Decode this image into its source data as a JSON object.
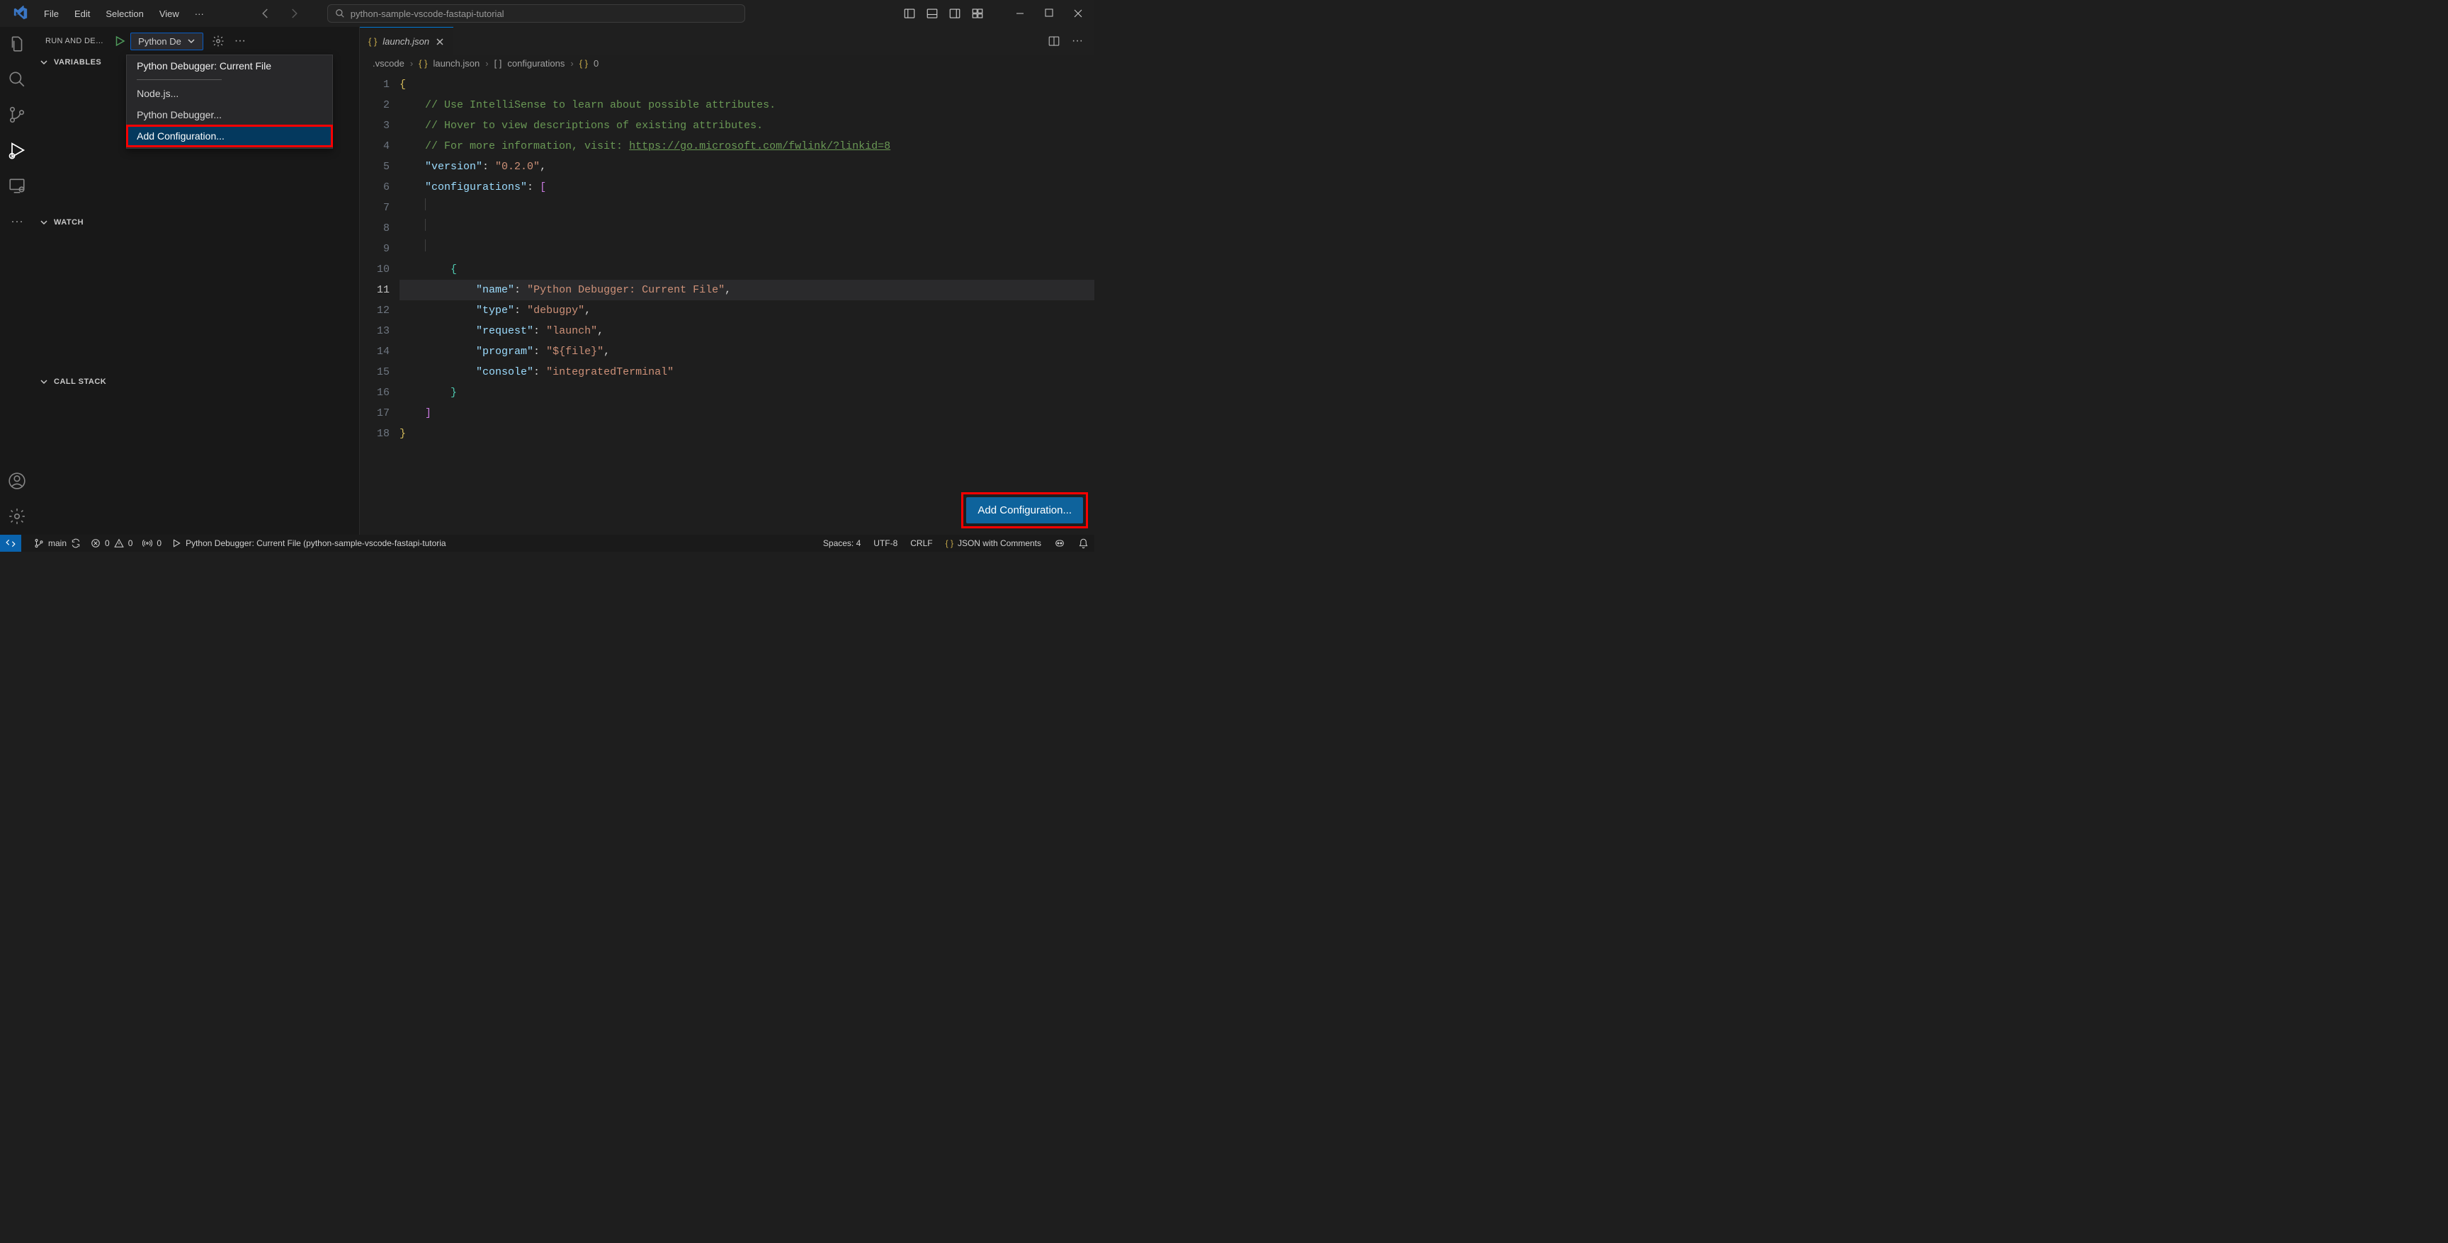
{
  "titlebar": {
    "menus": [
      "File",
      "Edit",
      "Selection",
      "View"
    ],
    "search_placeholder": "python-sample-vscode-fastapi-tutorial"
  },
  "sidepanel": {
    "title": "RUN AND DE…",
    "selected_config": "Python De",
    "dropdown": {
      "items": [
        {
          "label": "Python Debugger: Current File",
          "accent": true
        },
        {
          "label": "Node.js..."
        },
        {
          "label": "Python Debugger..."
        },
        {
          "label": "Add Configuration...",
          "selected": true,
          "highlight": true
        }
      ]
    },
    "sections": [
      "VARIABLES",
      "WATCH",
      "CALL STACK"
    ]
  },
  "editor": {
    "tab": {
      "icon": "{}",
      "label": "launch.json"
    },
    "breadcrumb": [
      ".vscode",
      "launch.json",
      "configurations",
      "0"
    ],
    "add_config_label": "Add Configuration...",
    "code_lines": [
      {
        "n": 1,
        "raw": "{",
        "kind": "brace"
      },
      {
        "n": 2,
        "raw": "    // Use IntelliSense to learn about possible attributes.",
        "kind": "comment"
      },
      {
        "n": 3,
        "raw": "    // Hover to view descriptions of existing attributes.",
        "kind": "comment"
      },
      {
        "n": 4,
        "raw": "    // For more information, visit: https://go.microsoft.com/fwlink/?linkid=8",
        "kind": "comment-link"
      },
      {
        "n": 5,
        "raw": "    \"version\": \"0.2.0\",",
        "kind": "kv",
        "key": "version",
        "val": "0.2.0"
      },
      {
        "n": 6,
        "raw": "    \"configurations\": [",
        "kind": "key-arr",
        "key": "configurations"
      },
      {
        "n": 7,
        "raw": "",
        "kind": "blank"
      },
      {
        "n": 8,
        "raw": "",
        "kind": "blank"
      },
      {
        "n": 9,
        "raw": "",
        "kind": "blank"
      },
      {
        "n": 10,
        "raw": "        {",
        "kind": "brace2"
      },
      {
        "n": 11,
        "raw": "            \"name\": \"Python Debugger: Current File\",",
        "kind": "kv2",
        "key": "name",
        "val": "Python Debugger: Current File",
        "current": true
      },
      {
        "n": 12,
        "raw": "            \"type\": \"debugpy\",",
        "kind": "kv2",
        "key": "type",
        "val": "debugpy"
      },
      {
        "n": 13,
        "raw": "            \"request\": \"launch\",",
        "kind": "kv2",
        "key": "request",
        "val": "launch"
      },
      {
        "n": 14,
        "raw": "            \"program\": \"${file}\",",
        "kind": "kv2",
        "key": "program",
        "val": "${file}"
      },
      {
        "n": 15,
        "raw": "            \"console\": \"integratedTerminal\"",
        "kind": "kv2-last",
        "key": "console",
        "val": "integratedTerminal"
      },
      {
        "n": 16,
        "raw": "        }",
        "kind": "brace2-close"
      },
      {
        "n": 17,
        "raw": "    ]",
        "kind": "arr-close"
      },
      {
        "n": 18,
        "raw": "}",
        "kind": "brace-close"
      }
    ]
  },
  "statusbar": {
    "branch": "main",
    "errors": "0",
    "warnings": "0",
    "ports": "0",
    "debug_target": "Python Debugger: Current File (python-sample-vscode-fastapi-tutoria",
    "spaces": "Spaces: 4",
    "encoding": "UTF-8",
    "eol": "CRLF",
    "lang": "JSON with Comments"
  }
}
